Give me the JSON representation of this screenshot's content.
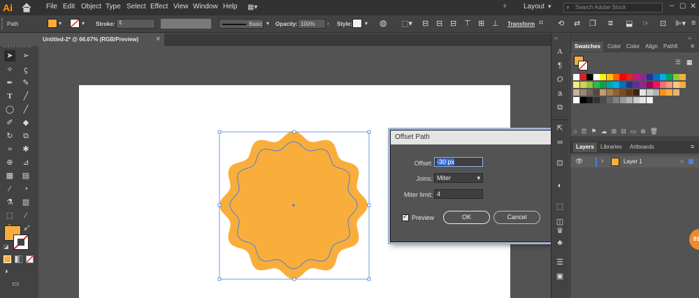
{
  "app": {
    "logo": "Ai",
    "menu": [
      "File",
      "Edit",
      "Object",
      "Type",
      "Select",
      "Effect",
      "View",
      "Window",
      "Help"
    ],
    "workspace": "Layout",
    "search_placeholder": "Search Adobe Stock"
  },
  "control_bar": {
    "selection_label": "Path",
    "stroke_label": "Stroke:",
    "brush_label": "Basic",
    "opacity_label": "Opacity:",
    "opacity_value": "100%",
    "style_label": "Style:",
    "transform_label": "Transform",
    "fill_color": "#f9ae3b"
  },
  "document": {
    "tab_title": "Untitled-2* @ 66.67% (RGB/Preview)",
    "close_glyph": "×"
  },
  "panels": {
    "top_tabs": [
      "Swatches",
      "Color",
      "Color",
      "Align",
      "Pathfi"
    ],
    "bottom_tabs": [
      "Layers",
      "Libraries",
      "Artboards"
    ],
    "layer_name": "Layer 1"
  },
  "dialog": {
    "title": "Offset Path",
    "offset_label": "Offset:",
    "offset_value": "-30 px",
    "joins_label": "Joins:",
    "joins_value": "Miter",
    "miter_label": "Miter limit:",
    "miter_value": "4",
    "preview_label": "Preview",
    "ok_label": "OK",
    "cancel_label": "Cancel"
  },
  "badge": {
    "text": "81"
  },
  "colors": {
    "shape_fill": "#f9ae3b",
    "selection": "#4c7fe0",
    "accent_orange": "#ff9a00"
  }
}
